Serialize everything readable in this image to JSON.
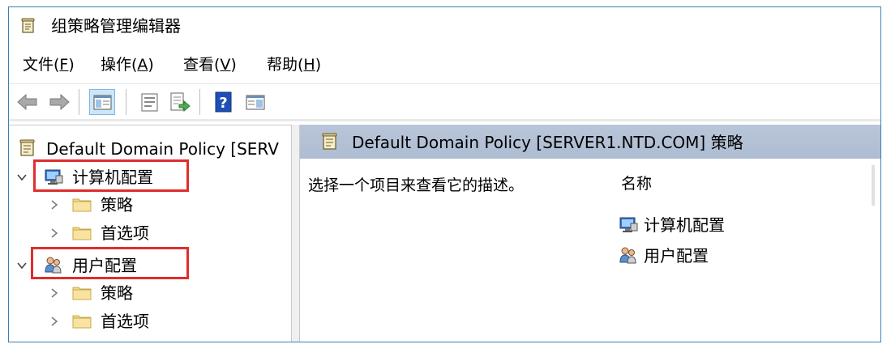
{
  "window": {
    "title": "组策略管理编辑器"
  },
  "menu": [
    {
      "text": "文件(",
      "acc": "F",
      "close": ")"
    },
    {
      "text": "操作(",
      "acc": "A",
      "close": ")"
    },
    {
      "text": "查看(",
      "acc": "V",
      "close": ")"
    },
    {
      "text": "帮助(",
      "acc": "H",
      "close": ")"
    }
  ],
  "toolbar": {
    "buttons": [
      "back-arrow",
      "forward-arrow",
      "show-hide-console-tree",
      "properties",
      "export-list",
      "help",
      "show-hide-action-pane"
    ]
  },
  "tree": {
    "root": "Default Domain Policy [SERV",
    "nodes": [
      {
        "label": "计算机配置",
        "children": [
          "策略",
          "首选项"
        ]
      },
      {
        "label": "用户配置",
        "children": [
          "策略",
          "首选项"
        ]
      }
    ]
  },
  "details": {
    "header": "Default Domain Policy [SERVER1.NTD.COM] 策略",
    "description": "选择一个项目来查看它的描述。",
    "column_name": "名称",
    "items": [
      "计算机配置",
      "用户配置"
    ]
  },
  "highlight_color": "#e02d2d"
}
